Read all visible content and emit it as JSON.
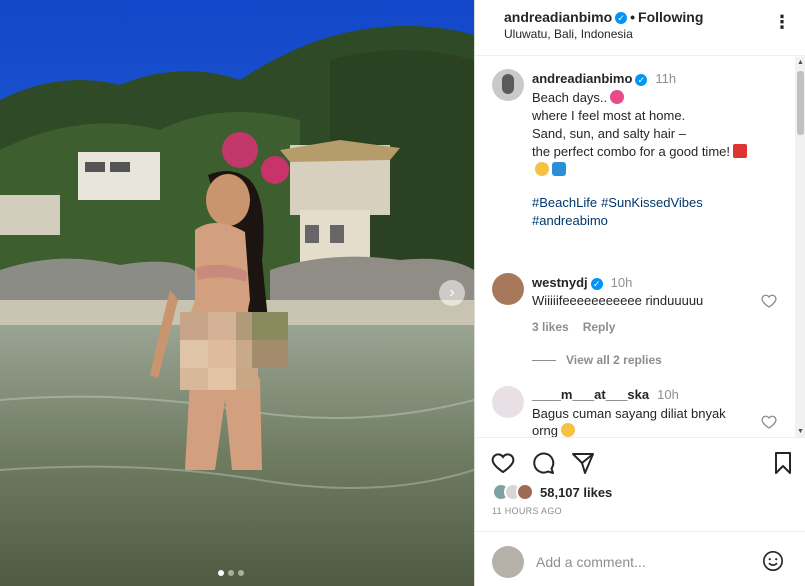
{
  "post": {
    "username": "andreadianbimo",
    "follow_separator": "•",
    "follow_label": "Following",
    "location": "Uluwatu, Bali, Indonesia",
    "more_icon": "more-horizontal-icon"
  },
  "caption": {
    "username": "andreadianbimo",
    "time": "11h",
    "lines": [
      "Beach days..",
      "where I feel most at home.",
      "Sand, sun, and salty hair –",
      "the perfect combo for a good time!"
    ],
    "hashtags": [
      "#BeachLife",
      "#SunKissedVibes",
      "#andreabimo"
    ]
  },
  "comments": [
    {
      "username": "westnydj",
      "time": "10h",
      "text": "Wiiiiifeeeeeeeeeee rinduuuuu",
      "likes_label": "3 likes",
      "reply_label": "Reply",
      "view_replies": "View all 2 replies"
    },
    {
      "username": "____m___at___ska",
      "time": "10h",
      "text": "Bagus cuman sayang diliat bnyak orng"
    }
  ],
  "footer": {
    "likes": "58,107 likes",
    "posted_ago": "11 HOURS AGO",
    "comment_placeholder": "Add a comment..."
  },
  "colors": {
    "verified": "#0095f6",
    "hashtag": "#00376b",
    "muted": "#8e8e8e"
  },
  "carousel": {
    "total": 3,
    "active": 1
  }
}
